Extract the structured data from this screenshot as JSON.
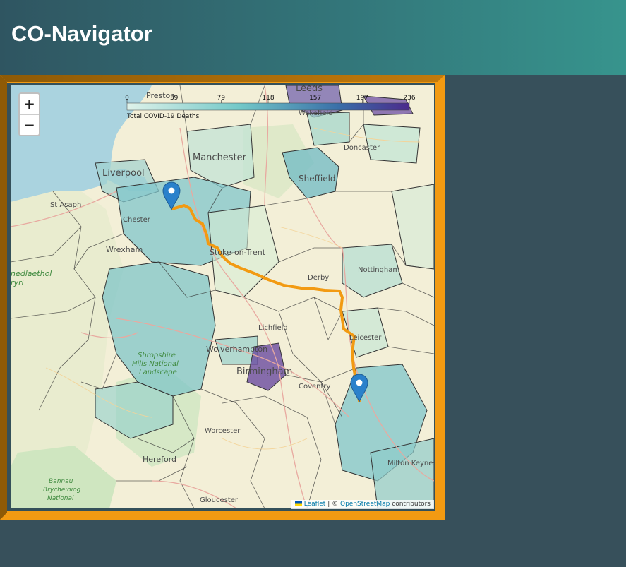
{
  "app": {
    "title": "CO-Navigator"
  },
  "map": {
    "zoom": {
      "in_label": "+",
      "out_label": "−"
    },
    "legend": {
      "title": "Total COVID-19 Deaths",
      "ticks": [
        "0",
        "39",
        "79",
        "118",
        "157",
        "197",
        "236"
      ],
      "color_range": [
        "#dff2ea",
        "#72c8c8",
        "#3a6fa8",
        "#4b2a8c"
      ]
    },
    "route_color": "#f29a12",
    "markers": [
      {
        "name": "start",
        "place": "Chester"
      },
      {
        "name": "end",
        "place": "Coventry"
      }
    ],
    "places": [
      "Preston",
      "Leeds",
      "Wakefield",
      "Manchester",
      "Liverpool",
      "Doncaster",
      "Sheffield",
      "St Asaph",
      "Chester",
      "Wrexham",
      "Stoke-on-Trent",
      "Nottingham",
      "Derby",
      "Lichfield",
      "Leicester",
      "Wolverhampton",
      "Birmingham",
      "Coventry",
      "Worcester",
      "Hereford",
      "Gloucester",
      "Milton Keynes"
    ],
    "natural_areas": [
      "Shropshire Hills National Landscape",
      "Bannau Brycheiniog National Park",
      "Snowdonia / Eryri"
    ],
    "attribution": {
      "leaflet": "Leaflet",
      "separator": "| ©",
      "osm": "OpenStreetMap",
      "suffix": "contributors"
    }
  }
}
